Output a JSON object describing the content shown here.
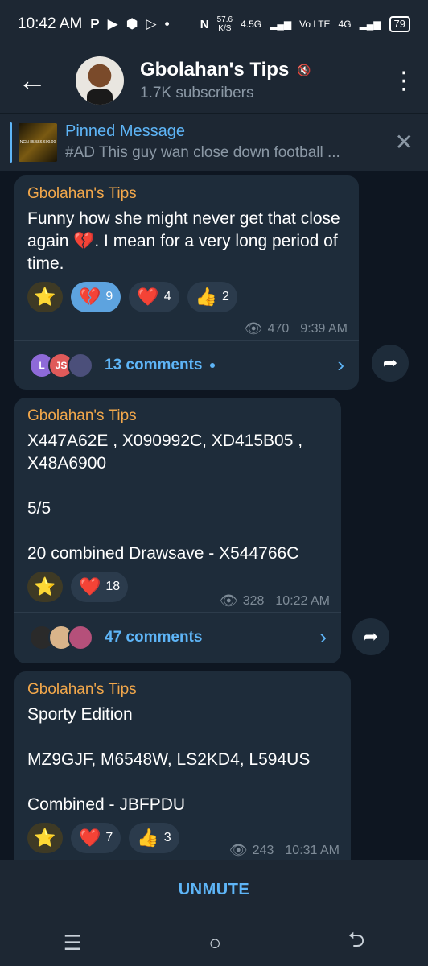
{
  "status_bar": {
    "time": "10:42 AM",
    "left_icons": [
      "P",
      "▶",
      "android",
      "▷",
      "•"
    ],
    "speed_value": "57.6",
    "speed_unit": "K/S",
    "network": "4.5G",
    "volte": "Vo LTE",
    "network2": "4G",
    "battery": "79"
  },
  "header": {
    "title": "Gbolahan's Tips",
    "subscribers": "1.7K subscribers"
  },
  "pinned": {
    "title": "Pinned Message",
    "thumb_text": "NGN 85,556,600.00",
    "preview": "#AD   This guy wan close down football ..."
  },
  "messages": [
    {
      "author": "Gbolahan's Tips",
      "text": "Funny how she might never get that close again 💔. I mean for a very long period of time.",
      "reactions": [
        {
          "emoji": "⭐",
          "count": ""
        },
        {
          "emoji": "💔",
          "count": "9"
        },
        {
          "emoji": "❤️",
          "count": "4"
        },
        {
          "emoji": "👍",
          "count": "2"
        }
      ],
      "views": "470",
      "time": "9:39 AM",
      "comment_avatars": [
        "L",
        "JS",
        ""
      ],
      "comments": "13 comments"
    },
    {
      "author": "Gbolahan's Tips",
      "text": "X447A62E , X090992C, XD415B05 , X48A6900\n\n5/5\n\n20 combined Drawsave - X544766C",
      "reactions": [
        {
          "emoji": "⭐",
          "count": ""
        },
        {
          "emoji": "❤️",
          "count": "18"
        }
      ],
      "views": "328",
      "time": "10:22 AM",
      "comments": "47 comments"
    },
    {
      "author": "Gbolahan's Tips",
      "text": "Sporty Edition\n\nMZ9GJF, M6548W, LS2KD4, L594US\n\nCombined - JBFPDU",
      "reactions": [
        {
          "emoji": "⭐",
          "count": ""
        },
        {
          "emoji": "❤️",
          "count": "7"
        },
        {
          "emoji": "👍",
          "count": "3"
        }
      ],
      "views": "243",
      "time": "10:31 AM"
    }
  ],
  "unmute_label": "UNMUTE",
  "nav": {
    "recents": "☰",
    "home": "○",
    "back": "⮌"
  },
  "colors": {
    "accent": "#5eb5f7",
    "author": "#f3a84b",
    "bubble": "#1e2c3a"
  }
}
